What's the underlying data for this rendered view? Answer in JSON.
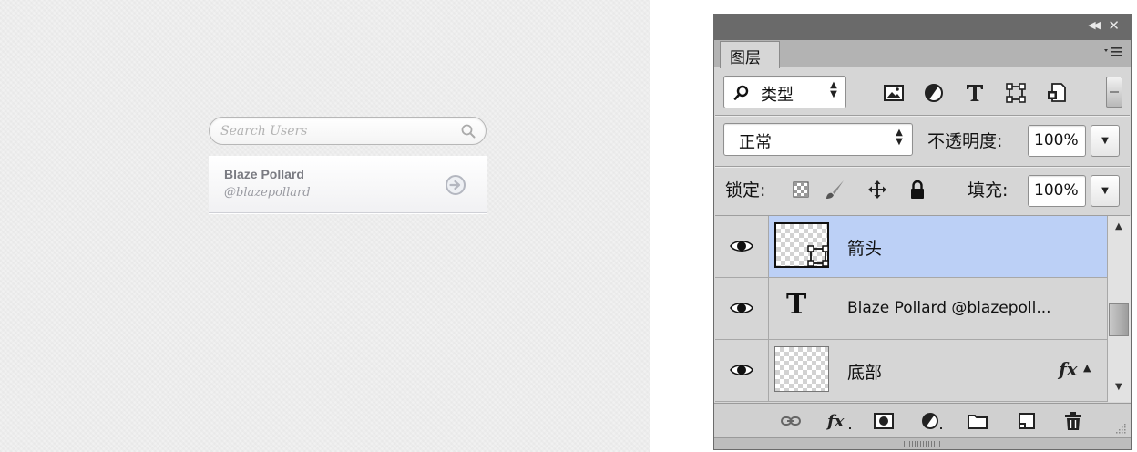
{
  "preview": {
    "search": {
      "placeholder": "Search Users",
      "icon": "search-icon"
    },
    "user": {
      "name": "Blaze Pollard",
      "handle": "@blazepollard",
      "action_icon": "arrow-circle-right-icon"
    }
  },
  "panel": {
    "tab_label": "图层",
    "filter": {
      "label": "类型"
    },
    "blend_mode": {
      "value": "正常"
    },
    "opacity": {
      "label": "不透明度:",
      "value": "100%"
    },
    "lock": {
      "label": "锁定:"
    },
    "fill": {
      "label": "填充:",
      "value": "100%"
    },
    "layers": [
      {
        "name": "箭头",
        "kind": "shape",
        "selected": true
      },
      {
        "name": "Blaze Pollard @blazepoll...",
        "kind": "text",
        "selected": false
      },
      {
        "name": "底部",
        "kind": "pixel",
        "fx": "fx",
        "selected": false
      }
    ],
    "colors": {
      "selection": "#bcd0f6",
      "panel_bg": "#d6d6d6",
      "titlebar": "#6a6a6a"
    }
  }
}
